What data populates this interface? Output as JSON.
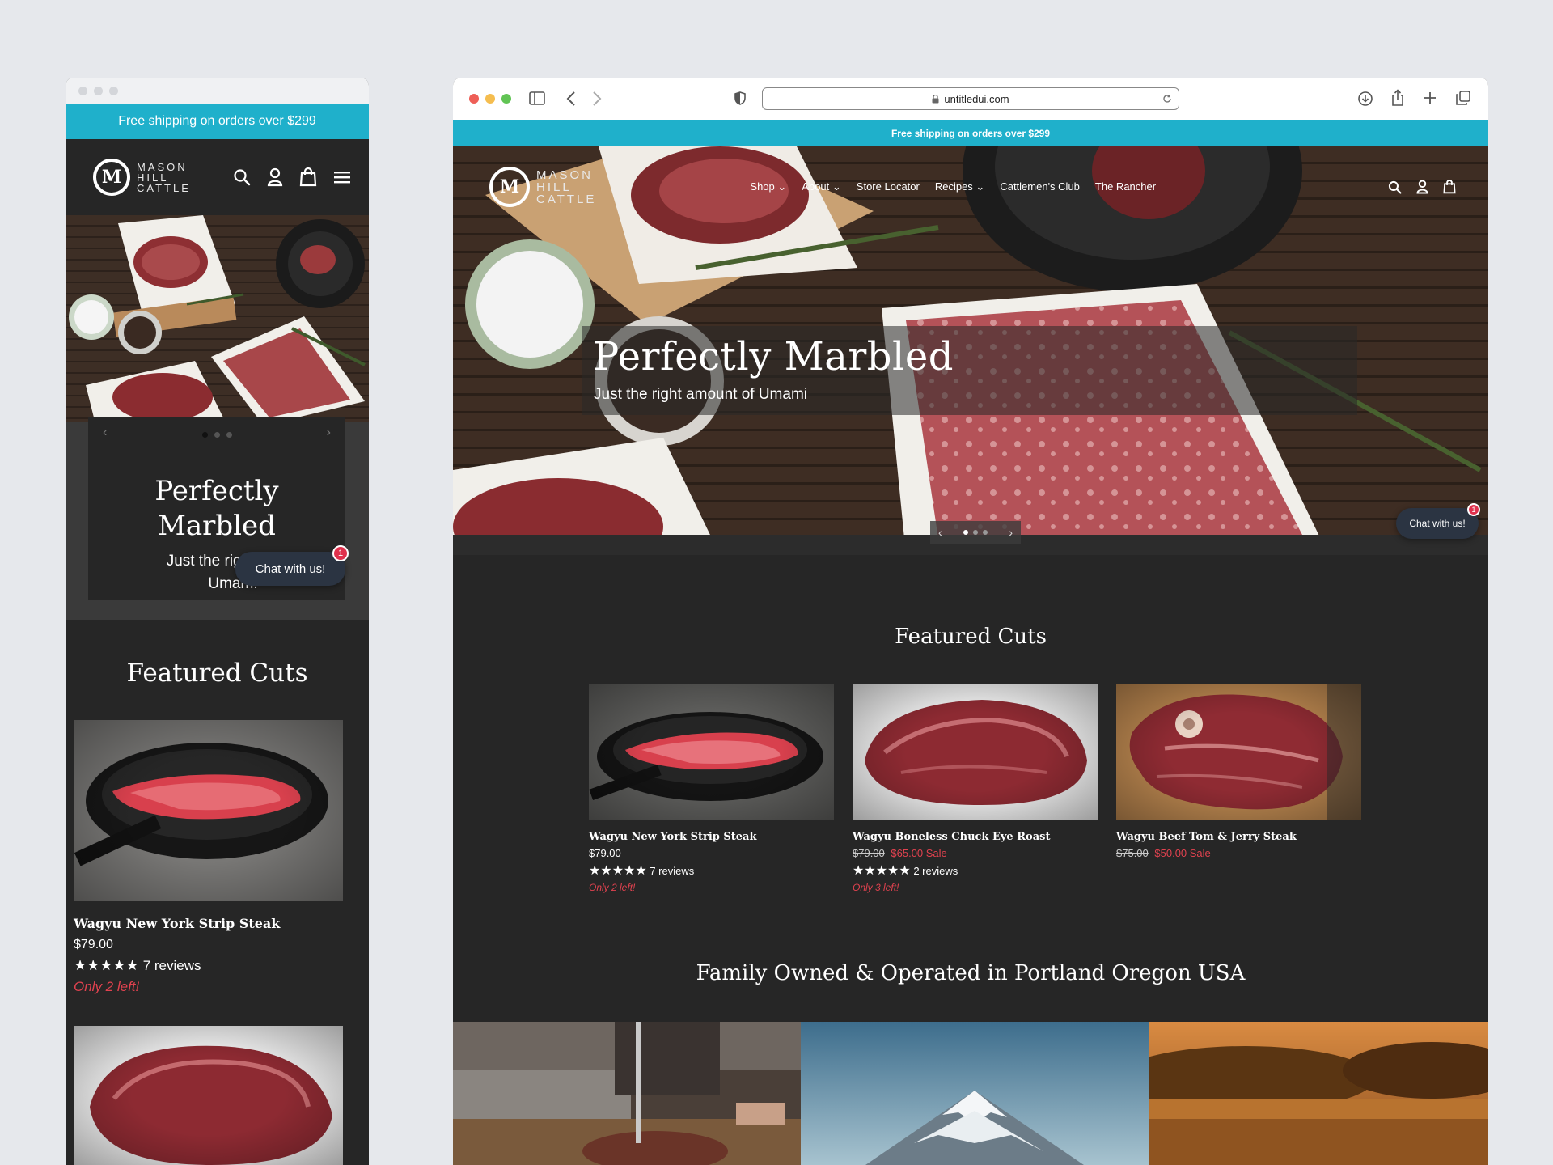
{
  "announcement": "Free shipping on orders over $299",
  "brand": {
    "monogram": "M",
    "words": [
      "MASON",
      "HILL",
      "CATTLE"
    ]
  },
  "browser": {
    "url": "untitledui.com"
  },
  "nav": {
    "links": [
      "Shop",
      "About",
      "Store Locator",
      "Recipes",
      "Cattlemen's Club",
      "The Rancher"
    ],
    "dropdowns": [
      "Shop",
      "About",
      "Recipes"
    ]
  },
  "hero": {
    "title": "Perfectly Marbled",
    "mobile_title_line1": "Perfectly",
    "mobile_title_line2": "Marbled",
    "subtitle": "Just the right amount of Umami",
    "mobile_subtitle_line1": "Just the right a",
    "mobile_subtitle_line2": "Umam."
  },
  "chat": {
    "label": "Chat with us!",
    "mobile_label": "Chat with us!",
    "badge": "1"
  },
  "featured": {
    "title": "Featured Cuts",
    "products": [
      {
        "name": "Wagyu New York Strip Steak",
        "price": "$79.00",
        "stars": "★★★★★",
        "reviews": "7 reviews",
        "stock": "Only 2 left!"
      },
      {
        "name": "Wagyu Boneless Chuck Eye Roast",
        "old_price": "$79.00",
        "sale_price": "$65.00 Sale",
        "stars": "★★★★★",
        "reviews": "2 reviews",
        "stock": "Only 3 left!"
      },
      {
        "name": "Wagyu Beef Tom & Jerry Steak",
        "old_price": "$75.00",
        "sale_price": "$50.00 Sale"
      }
    ]
  },
  "family_heading": "Family Owned & Operated in Portland Oregon USA",
  "colors": {
    "announcement_bg": "#1fb0cb",
    "page_bg": "#262626",
    "sale": "#e0424f",
    "chat_bg": "#2b3442"
  }
}
